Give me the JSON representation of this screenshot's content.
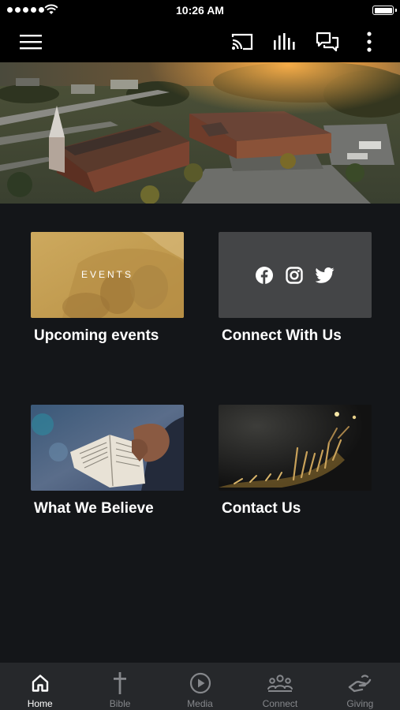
{
  "status_bar": {
    "time": "10:26 AM"
  },
  "header": {
    "icons": [
      "menu-icon",
      "cast-icon",
      "audio-icon",
      "chat-icon",
      "more-icon"
    ]
  },
  "hero": {
    "image": "church-aerial-sunset"
  },
  "cards": {
    "events": {
      "label": "EVENTS",
      "title": "Upcoming events"
    },
    "connect": {
      "title": "Connect With Us",
      "icons": [
        "facebook-icon",
        "instagram-icon",
        "twitter-icon"
      ]
    },
    "believe": {
      "title": "What We Believe"
    },
    "contact": {
      "title": "Contact Us"
    }
  },
  "tabs": [
    {
      "label": "Home",
      "icon": "home-icon",
      "active": true
    },
    {
      "label": "Bible",
      "icon": "cross-icon",
      "active": false
    },
    {
      "label": "Media",
      "icon": "play-icon",
      "active": false
    },
    {
      "label": "Connect",
      "icon": "group-icon",
      "active": false
    },
    {
      "label": "Giving",
      "icon": "giving-icon",
      "active": false
    }
  ],
  "colors": {
    "background": "#141619",
    "tab_bar": "#26282b",
    "active_tab": "#ffffff",
    "inactive_tab": "#85878b",
    "events_card": "#c9a45a"
  }
}
